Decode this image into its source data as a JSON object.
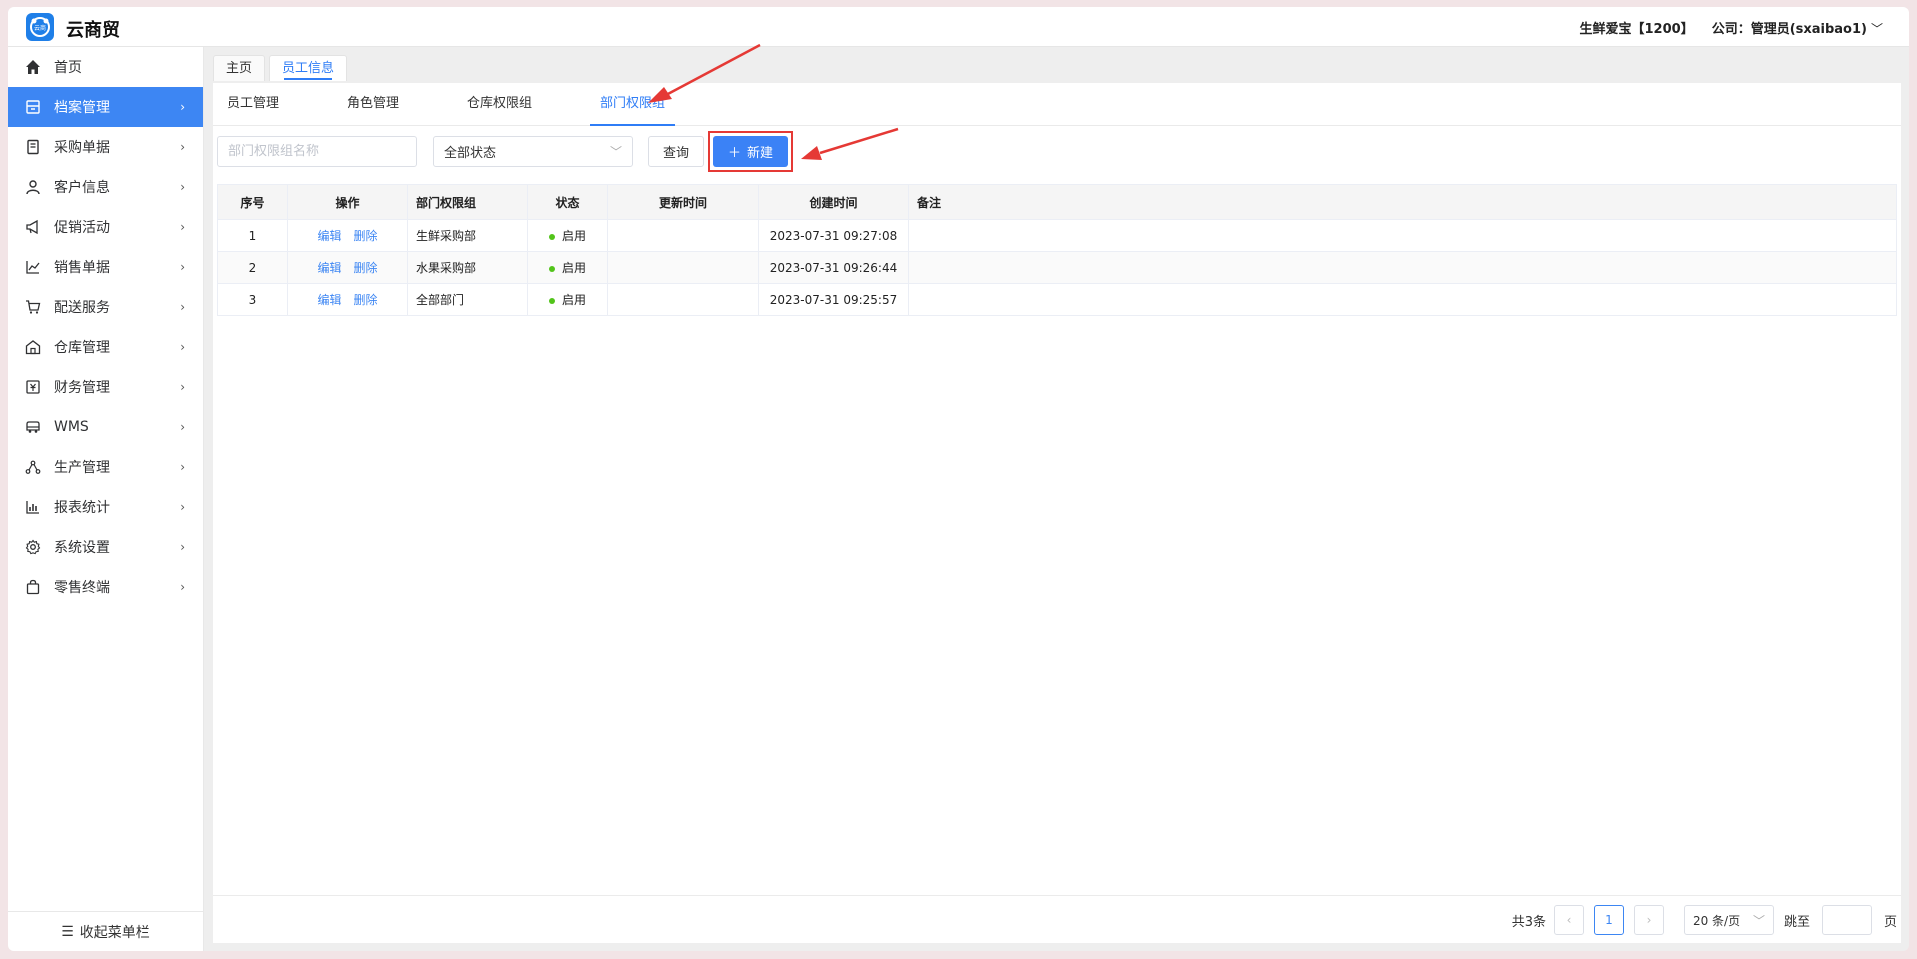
{
  "app": {
    "title": "云商贸",
    "logo_icon": "cloud-logo-icon",
    "logo_text": "云商"
  },
  "header": {
    "store": "生鲜爱宝【1200】",
    "company_user": "公司：管理员(sxaibao1)"
  },
  "sidebar": {
    "items": [
      {
        "label": "首页",
        "icon": "home-icon",
        "active": false,
        "has_arrow": false
      },
      {
        "label": "档案管理",
        "icon": "archive-icon",
        "active": true,
        "has_arrow": true
      },
      {
        "label": "采购单据",
        "icon": "purchase-doc-icon",
        "active": false,
        "has_arrow": true
      },
      {
        "label": "客户信息",
        "icon": "user-icon",
        "active": false,
        "has_arrow": true
      },
      {
        "label": "促销活动",
        "icon": "megaphone-icon",
        "active": false,
        "has_arrow": true
      },
      {
        "label": "销售单据",
        "icon": "chart-line-icon",
        "active": false,
        "has_arrow": true
      },
      {
        "label": "配送服务",
        "icon": "cart-icon",
        "active": false,
        "has_arrow": true
      },
      {
        "label": "仓库管理",
        "icon": "warehouse-icon",
        "active": false,
        "has_arrow": true
      },
      {
        "label": "财务管理",
        "icon": "finance-icon",
        "active": false,
        "has_arrow": true
      },
      {
        "label": "WMS",
        "icon": "truck-icon",
        "active": false,
        "has_arrow": true
      },
      {
        "label": "生产管理",
        "icon": "production-icon",
        "active": false,
        "has_arrow": true
      },
      {
        "label": "报表统计",
        "icon": "bar-chart-icon",
        "active": false,
        "has_arrow": true
      },
      {
        "label": "系统设置",
        "icon": "gear-icon",
        "active": false,
        "has_arrow": true
      },
      {
        "label": "零售终端",
        "icon": "bag-icon",
        "active": false,
        "has_arrow": true
      }
    ],
    "collapse_label": "收起菜单栏"
  },
  "page_tabs": [
    {
      "label": "主页",
      "active": false
    },
    {
      "label": "员工信息",
      "active": true
    }
  ],
  "sub_tabs": [
    {
      "label": "员工管理",
      "active": false
    },
    {
      "label": "角色管理",
      "active": false
    },
    {
      "label": "仓库权限组",
      "active": false
    },
    {
      "label": "部门权限组",
      "active": true
    }
  ],
  "filters": {
    "name_placeholder": "部门权限组名称",
    "status_value": "全部状态",
    "query_label": "查询",
    "new_label": "新建"
  },
  "table": {
    "columns": [
      "序号",
      "操作",
      "部门权限组",
      "状态",
      "更新时间",
      "创建时间",
      "备注"
    ],
    "edit_label": "编辑",
    "delete_label": "删除",
    "rows": [
      {
        "no": "1",
        "name": "生鲜采购部",
        "status": "启用",
        "updated": "",
        "created": "2023-07-31 09:27:08",
        "note": ""
      },
      {
        "no": "2",
        "name": "水果采购部",
        "status": "启用",
        "updated": "",
        "created": "2023-07-31 09:26:44",
        "note": ""
      },
      {
        "no": "3",
        "name": "全部部门",
        "status": "启用",
        "updated": "",
        "created": "2023-07-31 09:25:57",
        "note": ""
      }
    ]
  },
  "pagination": {
    "total": "共3条",
    "current_page": "1",
    "page_size": "20 条/页",
    "jump_label": "跳至",
    "page_unit": "页"
  },
  "colors": {
    "accent": "#3d86f3",
    "annotation": "#e53935",
    "status_ok": "#52c41a"
  }
}
